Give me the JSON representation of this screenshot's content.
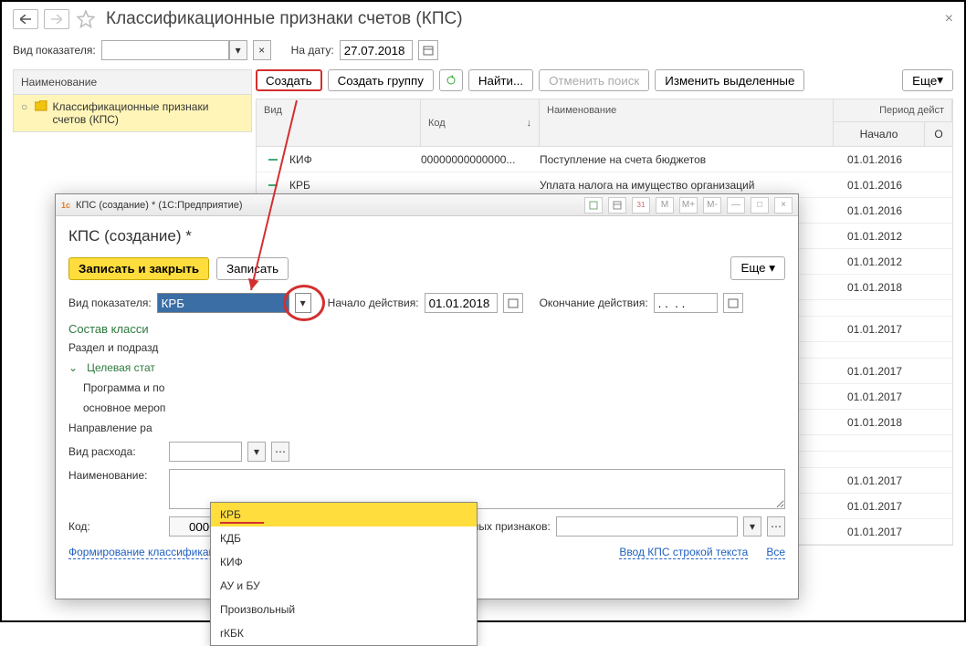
{
  "header": {
    "title": "Классификационные признаки счетов (КПС)"
  },
  "filter": {
    "vid_label": "Вид показателя:",
    "na_datu_label": "На дату:",
    "na_datu_value": "27.07.2018"
  },
  "toolbar": {
    "create": "Создать",
    "create_group": "Создать группу",
    "find": "Найти...",
    "cancel_search": "Отменить поиск",
    "edit_selected": "Изменить выделенные",
    "more": "Еще"
  },
  "tree": {
    "header": "Наименование",
    "item": "Классификационные признаки счетов (КПС)"
  },
  "grid": {
    "h_vid": "Вид",
    "h_kod": "Код",
    "h_naim": "Наименование",
    "h_period": "Период дейст",
    "h_nachalo": "Начало",
    "h_ok": "О",
    "rows": [
      {
        "vid": "КИФ",
        "kod": "00000000000000...",
        "naim": "Поступление на счета бюджетов",
        "nach": "01.01.2016"
      },
      {
        "vid": "КРБ",
        "kod": "",
        "naim": "Уплата налога на имущество организаций",
        "nach": "01.01.2016"
      },
      {
        "vid": "",
        "kod": "",
        "naim": "",
        "nach": "01.01.2016"
      },
      {
        "vid": "",
        "kod": "",
        "naim": "",
        "nach": "01.01.2012"
      },
      {
        "vid": "",
        "kod": "",
        "naim": "",
        "nach": "01.01.2012"
      },
      {
        "vid": "",
        "kod": "",
        "naim": "",
        "nach": "01.01.2018"
      },
      {
        "vid": "",
        "kod": "",
        "naim": "",
        "nach": ""
      },
      {
        "vid": "",
        "kod": "",
        "naim": "",
        "nach": "01.01.2017"
      },
      {
        "vid": "",
        "kod": "",
        "naim": "",
        "nach": ""
      },
      {
        "vid": "",
        "kod": "",
        "naim": "",
        "nach": "01.01.2017"
      },
      {
        "vid": "",
        "kod": "",
        "naim": "",
        "nach": "01.01.2017"
      },
      {
        "vid": "",
        "kod": "",
        "naim": "",
        "nach": "01.01.2018"
      },
      {
        "vid": "",
        "kod": "",
        "naim": "",
        "nach": ""
      },
      {
        "vid": "",
        "kod": "",
        "naim": "",
        "nach": ""
      },
      {
        "vid": "",
        "kod": "",
        "naim": "",
        "nach": "01.01.2017"
      },
      {
        "vid": "",
        "kod": "",
        "naim": "",
        "nach": "01.01.2017"
      },
      {
        "vid": "",
        "kod": "",
        "naim": "",
        "nach": "01.01.2017"
      }
    ]
  },
  "dialog": {
    "win_title": "КПС (создание) * (1С:Предприятие)",
    "title": "КПС (создание) *",
    "save_close": "Записать и закрыть",
    "save": "Записать",
    "more": "Еще",
    "vid_label": "Вид показателя:",
    "vid_value": "КРБ",
    "nachalo_label": "Начало действия:",
    "nachalo_value": "01.01.2018",
    "okon_label": "Окончание действия:",
    "okon_value": ". .  . .",
    "section": "Состав класси",
    "razdel": "Раздел и подразд",
    "celevaya": "Целевая стат",
    "program": "Программа и по",
    "osnovnoe": "основное мероп",
    "napravlenie": "Направление ра",
    "vid_rashoda": "Вид расхода:",
    "naimenovanie": "Наименование:",
    "kod_label": "Код:",
    "kod_value": "00000000000000000",
    "group_label": "Группа классификационных признаков:",
    "link1": "Формирование классификационных признаков счетов",
    "link2": "Ввод КПС строкой текста",
    "link3": "Все"
  },
  "dropdown": {
    "items": [
      "КРБ",
      "КДБ",
      "КИФ",
      "АУ и БУ",
      "Произвольный",
      "rКБК"
    ]
  }
}
